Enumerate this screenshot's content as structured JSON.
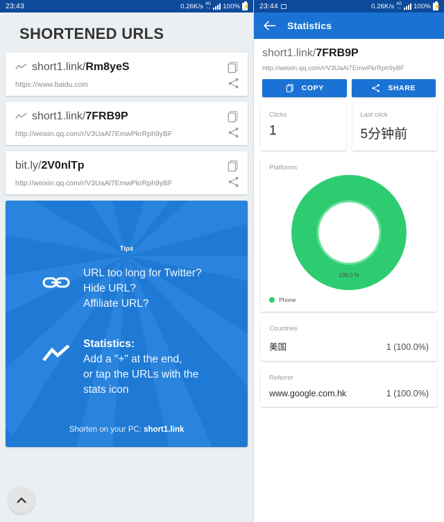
{
  "status_bar_left": {
    "time": "23:43",
    "net_speed": "0.26K/s",
    "network_type": "4G",
    "battery": "100%"
  },
  "status_bar_right": {
    "time": "23:44",
    "net_speed": "0.26K/s",
    "network_type": "4G",
    "battery": "100%",
    "photo_icon": "image-icon"
  },
  "left_panel": {
    "title": "SHORTENED URLS",
    "cards": [
      {
        "short_url_prefix": "short1.link/",
        "short_url_code": "Rm8yeS",
        "long_url": "https://www.baidu.com",
        "has_stats_icon": true,
        "copy_icon": "copy-icon",
        "share_icon": "share-icon"
      },
      {
        "short_url_prefix": "short1.link/",
        "short_url_code": "7FRB9P",
        "long_url": "http://weixin.qq.com/r/V3UaAl7EmwPkrRph9yBF",
        "has_stats_icon": true,
        "copy_icon": "copy-icon",
        "share_icon": "share-icon"
      },
      {
        "short_url_prefix": "bit.ly/",
        "short_url_code": "2V0nlTp",
        "long_url": "http://weixin.qq.com/r/V3UaAl7EmwPkrRph9yBF",
        "has_stats_icon": false,
        "copy_icon": "copy-icon",
        "share_icon": "share-icon"
      }
    ],
    "tips": {
      "label": "Tips",
      "link_icon": "chain-link-icon",
      "stats_icon": "trending-up-icon",
      "block1_line1": "URL too long for Twitter?",
      "block1_line2": "Hide URL?",
      "block1_line3": "Affiliate URL?",
      "block2_heading": "Statistics:",
      "block2_line1": "Add a \"+\" at the end,",
      "block2_line2": "or tap the URLs with the",
      "block2_line3": "stats icon",
      "footer_prefix": "Shorten on your PC: ",
      "footer_link": "short1.link"
    },
    "scroll_top_fab": {
      "icon": "chevron-up-icon"
    }
  },
  "right_panel": {
    "appbar": {
      "back_icon": "arrow-back-icon",
      "title": "Statistics"
    },
    "header": {
      "short_url_prefix": "short1.link/",
      "short_url_code": "7FRB9P",
      "long_url": "http://weixin.qq.com/r/V3UaAl7EmwPkrRph9yBF"
    },
    "actions": [
      {
        "label": "COPY",
        "icon": "copy-icon"
      },
      {
        "label": "SHARE",
        "icon": "share-icon"
      }
    ],
    "stats": {
      "clicks_label": "Clicks",
      "clicks_value": "1",
      "last_click_label": "Last click",
      "last_click_value": "5分钟前"
    },
    "platforms": {
      "label": "Platforms",
      "center_label": "100.0 %",
      "legend_label": "Phone"
    },
    "countries": {
      "label": "Countries",
      "name": "美国",
      "value": "1 (100.0%)"
    },
    "referrer": {
      "label": "Referrer",
      "name": "www.google.com.hk",
      "value": "1 (100.0%)"
    }
  },
  "colors": {
    "status_bar": "#0d4a9b",
    "accent_blue": "#1a73d4",
    "tips_blue": "#1e7ad4",
    "donut_green": "#2ecc71",
    "left_bg": "#eceff1"
  },
  "chart_data": {
    "type": "pie",
    "title": "Platforms",
    "categories": [
      "Phone"
    ],
    "values": [
      100.0
    ],
    "labels": [
      "100.0 %"
    ],
    "colors": [
      "#2ecc71"
    ],
    "legend_position": "bottom-left",
    "donut": true,
    "inner_radius_ratio": 0.52
  }
}
